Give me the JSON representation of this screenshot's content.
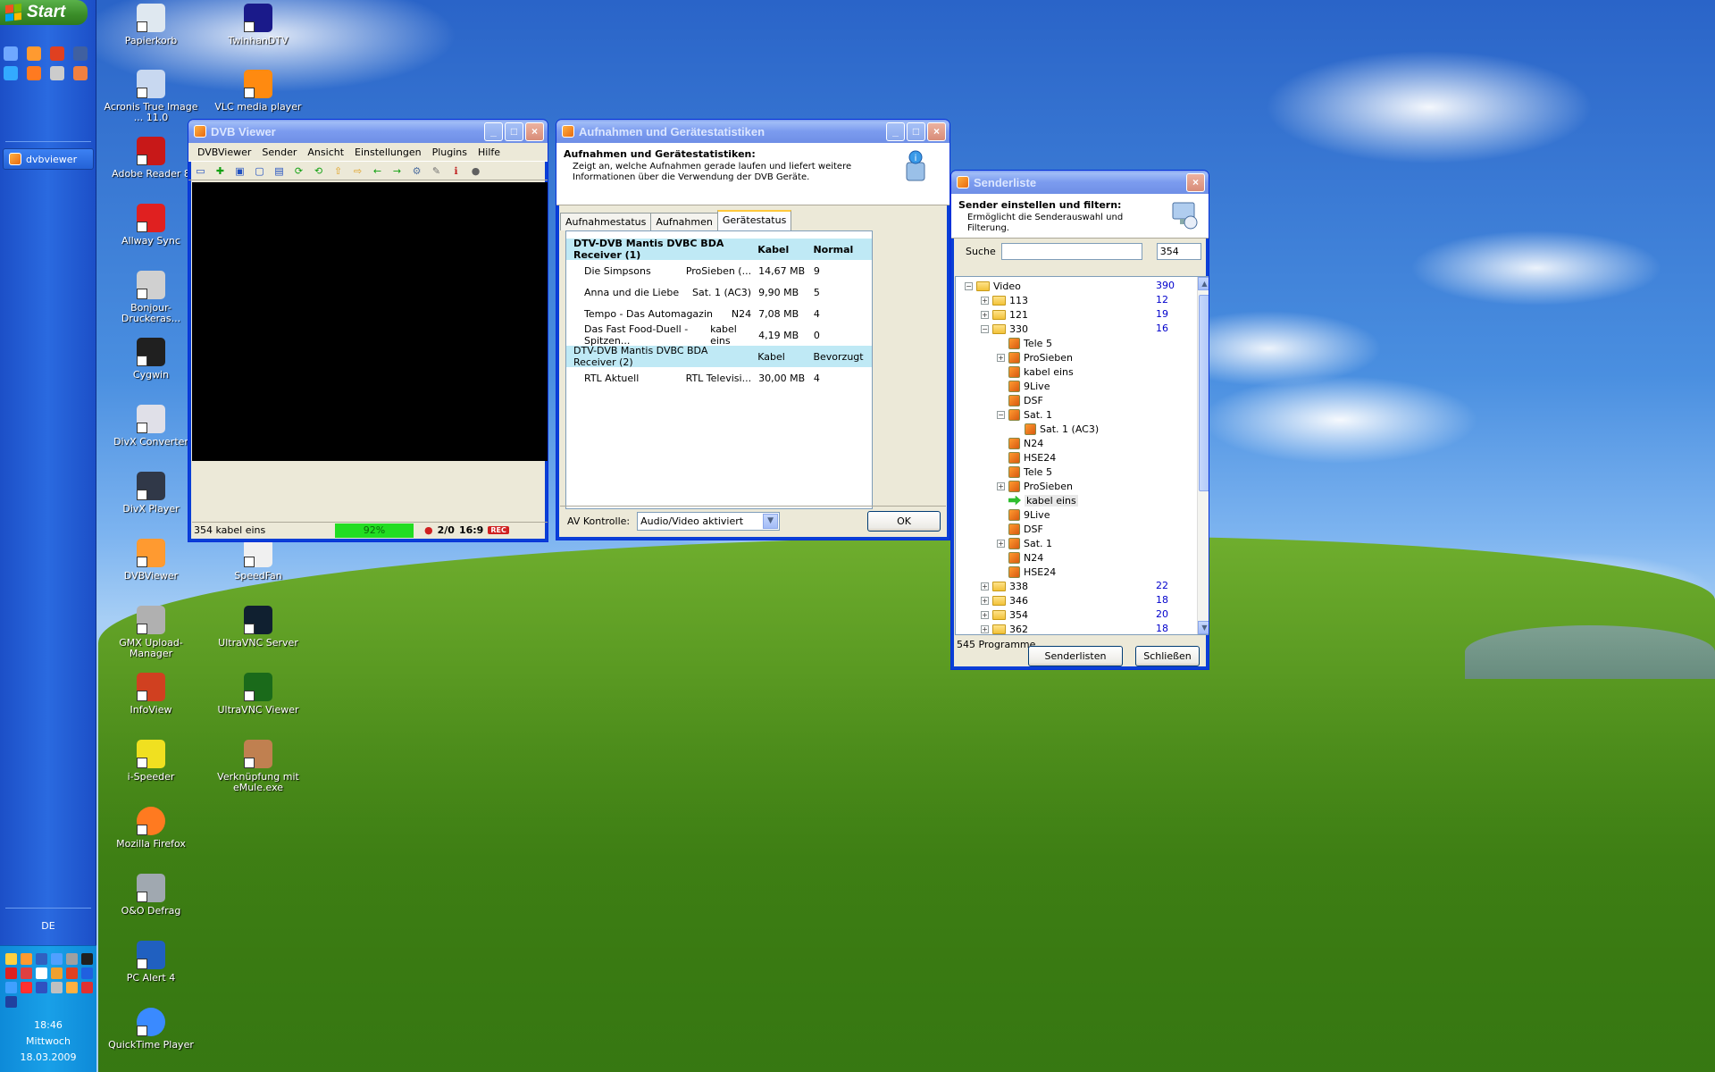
{
  "taskbar": {
    "start_label": "Start",
    "task_button": "dvbviewer",
    "language": "DE",
    "clock": {
      "time": "18:46",
      "day": "Mittwoch",
      "date": "18.03.2009"
    }
  },
  "desktop_icons": [
    {
      "label": "Papierkorb",
      "icon": "recycle-bin-icon"
    },
    {
      "label": "TwinhanDTV",
      "icon": "twinhan-icon"
    },
    {
      "label": "Acronis True Image ... 11.0",
      "icon": "acronis-icon"
    },
    {
      "label": "VLC media player",
      "icon": "vlc-icon"
    },
    {
      "label": "Adobe Reader 8",
      "icon": "adobe-reader-icon"
    },
    {
      "label": "Allway Sync",
      "icon": "allway-sync-icon"
    },
    {
      "label": "Bonjour-Druckeras...",
      "icon": "printer-icon"
    },
    {
      "label": "Cygwin",
      "icon": "cygwin-icon"
    },
    {
      "label": "DivX Converter",
      "icon": "divx-converter-icon"
    },
    {
      "label": "DivX Player",
      "icon": "divx-player-icon"
    },
    {
      "label": "DVBViewer",
      "icon": "dvbviewer-icon"
    },
    {
      "label": "SpeedFan",
      "icon": "speedfan-icon"
    },
    {
      "label": "GMX Upload-Manager",
      "icon": "gmx-icon"
    },
    {
      "label": "UltraVNC Server",
      "icon": "ultravnc-server-icon"
    },
    {
      "label": "InfoView",
      "icon": "infoview-icon"
    },
    {
      "label": "UltraVNC Viewer",
      "icon": "ultravnc-viewer-icon"
    },
    {
      "label": "i-Speeder",
      "icon": "ispeeder-icon"
    },
    {
      "label": "Verknüpfung mit eMule.exe",
      "icon": "emule-icon"
    },
    {
      "label": "Mozilla Firefox",
      "icon": "firefox-icon"
    },
    {
      "label": "O&O Defrag",
      "icon": "defrag-icon"
    },
    {
      "label": "PC Alert 4",
      "icon": "pc-alert-icon"
    },
    {
      "label": "QuickTime Player",
      "icon": "quicktime-icon"
    }
  ],
  "dvb_viewer": {
    "title": "DVB Viewer",
    "menu": [
      "DVBViewer",
      "Sender",
      "Ansicht",
      "Einstellungen",
      "Plugins",
      "Hilfe"
    ],
    "status": {
      "channel": "354 kabel eins",
      "signal": "92%",
      "counter": "2/0",
      "aspect": "16:9",
      "rec": "REC"
    }
  },
  "recordings": {
    "title": "Aufnahmen und Gerätestatistiken",
    "header_title": "Aufnahmen und Gerätestatistiken:",
    "header_desc": "Zeigt an, welche Aufnahmen gerade laufen und liefert weitere Informationen über die Verwendung der DVB Geräte.",
    "tabs": [
      "Aufnahmestatus",
      "Aufnahmen",
      "Gerätestatus"
    ],
    "groups": [
      {
        "name": "DTV-DVB Mantis DVBC BDA Receiver (1)",
        "type": "Kabel",
        "prio": "Normal",
        "rows": [
          {
            "name": "Die Simpsons",
            "channel": "ProSieben (...",
            "size": "14,67 MB",
            "count": "9"
          },
          {
            "name": "Anna und die Liebe",
            "channel": "Sat. 1 (AC3)",
            "size": "9,90 MB",
            "count": "5"
          },
          {
            "name": "Tempo - Das Automagazin",
            "channel": "N24",
            "size": "7,08 MB",
            "count": "4"
          },
          {
            "name": "Das Fast Food-Duell - Spitzen...",
            "channel": "kabel eins",
            "size": "4,19 MB",
            "count": "0"
          }
        ]
      },
      {
        "name": "DTV-DVB Mantis DVBC BDA Receiver (2)",
        "type": "Kabel",
        "prio": "Bevorzugt",
        "rows": [
          {
            "name": "RTL Aktuell",
            "channel": "RTL Televisi...",
            "size": "30,00 MB",
            "count": "4"
          }
        ]
      }
    ],
    "av_label": "AV Kontrolle:",
    "av_value": "Audio/Video aktiviert",
    "ok_label": "OK"
  },
  "senderliste": {
    "title": "Senderliste",
    "header_title": "Sender einstellen und filtern:",
    "header_desc": "Ermöglicht die Senderauswahl und Filterung.",
    "search_label": "Suche",
    "search_value": "",
    "number_value": "354",
    "tree": [
      {
        "label": "Video",
        "count": "390",
        "level": 0,
        "kind": "folder",
        "exp": "-"
      },
      {
        "label": "113",
        "count": "12",
        "level": 1,
        "kind": "folder",
        "exp": "+"
      },
      {
        "label": "121",
        "count": "19",
        "level": 1,
        "kind": "folder",
        "exp": "+"
      },
      {
        "label": "330",
        "count": "16",
        "level": 1,
        "kind": "folder",
        "exp": "-"
      },
      {
        "label": "Tele 5",
        "count": "",
        "level": 2,
        "kind": "chan",
        "exp": ""
      },
      {
        "label": "ProSieben",
        "count": "",
        "level": 2,
        "kind": "chan",
        "exp": "+"
      },
      {
        "label": "kabel eins",
        "count": "",
        "level": 2,
        "kind": "chan",
        "exp": ""
      },
      {
        "label": "9Live",
        "count": "",
        "level": 2,
        "kind": "chan",
        "exp": ""
      },
      {
        "label": "DSF",
        "count": "",
        "level": 2,
        "kind": "chan",
        "exp": ""
      },
      {
        "label": "Sat. 1",
        "count": "",
        "level": 2,
        "kind": "chan",
        "exp": "-"
      },
      {
        "label": "Sat. 1 (AC3)",
        "count": "",
        "level": 3,
        "kind": "chan",
        "exp": ""
      },
      {
        "label": "N24",
        "count": "",
        "level": 2,
        "kind": "chan",
        "exp": ""
      },
      {
        "label": "HSE24",
        "count": "",
        "level": 2,
        "kind": "chan",
        "exp": ""
      },
      {
        "label": "Tele 5",
        "count": "",
        "level": 2,
        "kind": "chan",
        "exp": ""
      },
      {
        "label": "ProSieben",
        "count": "",
        "level": 2,
        "kind": "chan",
        "exp": "+"
      },
      {
        "label": "kabel eins",
        "count": "",
        "level": 2,
        "kind": "active",
        "exp": ""
      },
      {
        "label": "9Live",
        "count": "",
        "level": 2,
        "kind": "chan",
        "exp": ""
      },
      {
        "label": "DSF",
        "count": "",
        "level": 2,
        "kind": "chan",
        "exp": ""
      },
      {
        "label": "Sat. 1",
        "count": "",
        "level": 2,
        "kind": "chan",
        "exp": "+"
      },
      {
        "label": "N24",
        "count": "",
        "level": 2,
        "kind": "chan",
        "exp": ""
      },
      {
        "label": "HSE24",
        "count": "",
        "level": 2,
        "kind": "chan",
        "exp": ""
      },
      {
        "label": "338",
        "count": "22",
        "level": 1,
        "kind": "folder",
        "exp": "+"
      },
      {
        "label": "346",
        "count": "18",
        "level": 1,
        "kind": "folder",
        "exp": "+"
      },
      {
        "label": "354",
        "count": "20",
        "level": 1,
        "kind": "folder",
        "exp": "+"
      },
      {
        "label": "362",
        "count": "18",
        "level": 1,
        "kind": "folder",
        "exp": "+"
      }
    ],
    "program_count": "545 Programme",
    "editor_label": "Senderlisten Editor",
    "close_label": "Schließen"
  }
}
